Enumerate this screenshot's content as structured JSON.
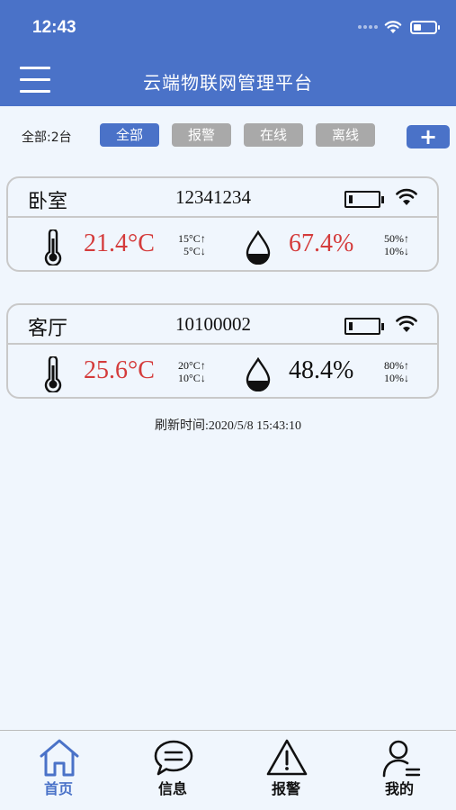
{
  "status_bar": {
    "time": "12:43"
  },
  "header": {
    "title": "云端物联网管理平台"
  },
  "filters": {
    "count_label": "全部:2台",
    "chips": [
      "全部",
      "报警",
      "在线",
      "离线"
    ],
    "active": "全部",
    "add_label": "+"
  },
  "devices": [
    {
      "name": "卧室",
      "id": "12341234",
      "temperature": "21.4°C",
      "temp_high": "15°C",
      "temp_low": "5°C",
      "humidity": "67.4%",
      "hum_high": "50%",
      "hum_low": "10%",
      "humidity_alarm": true
    },
    {
      "name": "客厅",
      "id": "10100002",
      "temperature": "25.6°C",
      "temp_high": "20°C",
      "temp_low": "10°C",
      "humidity": "48.4%",
      "hum_high": "80%",
      "hum_low": "10%",
      "humidity_alarm": false
    }
  ],
  "refresh_text": "刷新时间:2020/5/8 15:43:10",
  "tabs": [
    {
      "label": "首页",
      "icon": "home-icon",
      "active": true
    },
    {
      "label": "信息",
      "icon": "message-icon",
      "active": false
    },
    {
      "label": "报警",
      "icon": "warning-icon",
      "active": false
    },
    {
      "label": "我的",
      "icon": "user-icon",
      "active": false
    }
  ],
  "colors": {
    "brand": "#4a72c8",
    "alarm": "#d43b3b",
    "inactive_chip": "#a9a9a9",
    "background": "#f0f6fd"
  }
}
